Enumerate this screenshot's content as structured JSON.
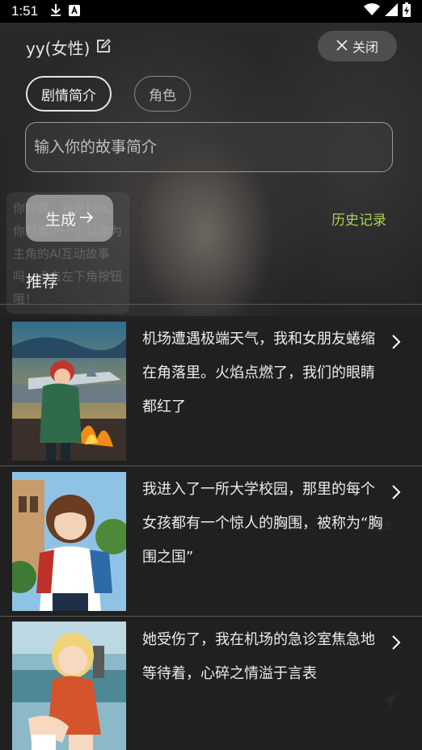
{
  "status_bar": {
    "time": "1:51",
    "icons": [
      "download-icon",
      "a-badge-icon",
      "wifi-icon",
      "signal-icon",
      "battery-charging-icon"
    ]
  },
  "header": {
    "title": "yy(女性)",
    "edit_icon": "edit-icon",
    "close_label": "关闭",
    "close_icon": "close-icon"
  },
  "tabs": [
    {
      "label": "剧情简介",
      "active": true
    },
    {
      "label": "角色",
      "active": false
    }
  ],
  "story_input": {
    "value": "",
    "placeholder": "输入你的故事简介"
  },
  "generate_button": {
    "label": "生成",
    "icon": "arrow-right-icon"
  },
  "history_link": "历史记录",
  "section_title": "推荐",
  "background_ghost_text": "你好啊，我是Ella。你想要听一个以你为主角的AI互动故事吗，点击左下角按钮哦！",
  "stories": [
    {
      "text": "机场遭遇极端天气，我和女朋友蜷缩在角落里。火焰点燃了，我们的眼睛都红了",
      "thumb": "airport-fire-illustration"
    },
    {
      "text": "我进入了一所大学校园，那里的每个女孩都有一个惊人的胸围，被称为“胸围之国”",
      "thumb": "campus-girl-illustration"
    },
    {
      "text": "她受伤了，我在机场的急诊室焦急地等待着，心碎之情溢于言表",
      "thumb": "injured-girl-illustration"
    }
  ],
  "colors": {
    "accent_green": "#a6d25a",
    "background": "#1c1c1c",
    "card_background": "#202020"
  }
}
